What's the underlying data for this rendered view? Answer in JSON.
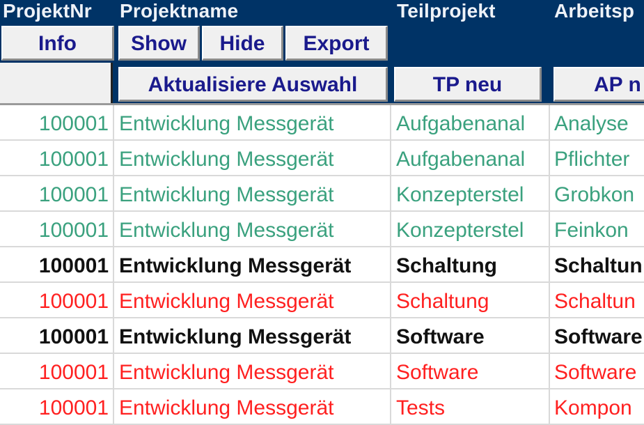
{
  "header": {
    "columns": [
      "ProjektNr",
      "Projektname",
      "Teilprojekt",
      "Arbeitsp"
    ],
    "buttons": {
      "info": "Info",
      "show": "Show",
      "hide": "Hide",
      "export": "Export",
      "refresh_selection": "Aktualisiere Auswahl",
      "tp_new": "TP neu",
      "ap_new": "AP n"
    }
  },
  "colors": {
    "header_bg": "#003366",
    "button_text": "#1a1a8c",
    "green_row": "#3aa17e",
    "red_row": "#ff2020",
    "bold_row": "#111111"
  },
  "rows": [
    {
      "nr": "100001",
      "name": "Entwicklung Messgerät",
      "tp": "Aufgabenanal",
      "ap": "Analyse",
      "style": "green"
    },
    {
      "nr": "100001",
      "name": "Entwicklung Messgerät",
      "tp": "Aufgabenanal",
      "ap": "Pflichter",
      "style": "green"
    },
    {
      "nr": "100001",
      "name": "Entwicklung Messgerät",
      "tp": "Konzepterstel",
      "ap": "Grobkon",
      "style": "green"
    },
    {
      "nr": "100001",
      "name": "Entwicklung Messgerät",
      "tp": "Konzepterstel",
      "ap": "Feinkon",
      "style": "green"
    },
    {
      "nr": "100001",
      "name": "Entwicklung Messgerät",
      "tp": "Schaltung",
      "ap": "Schaltun",
      "style": "bold"
    },
    {
      "nr": "100001",
      "name": "Entwicklung Messgerät",
      "tp": "Schaltung",
      "ap": "Schaltun",
      "style": "red"
    },
    {
      "nr": "100001",
      "name": "Entwicklung Messgerät",
      "tp": "Software",
      "ap": "Software",
      "style": "bold"
    },
    {
      "nr": "100001",
      "name": "Entwicklung Messgerät",
      "tp": "Software",
      "ap": "Software",
      "style": "red"
    },
    {
      "nr": "100001",
      "name": "Entwicklung Messgerät",
      "tp": "Tests",
      "ap": "Kompon",
      "style": "red"
    }
  ]
}
